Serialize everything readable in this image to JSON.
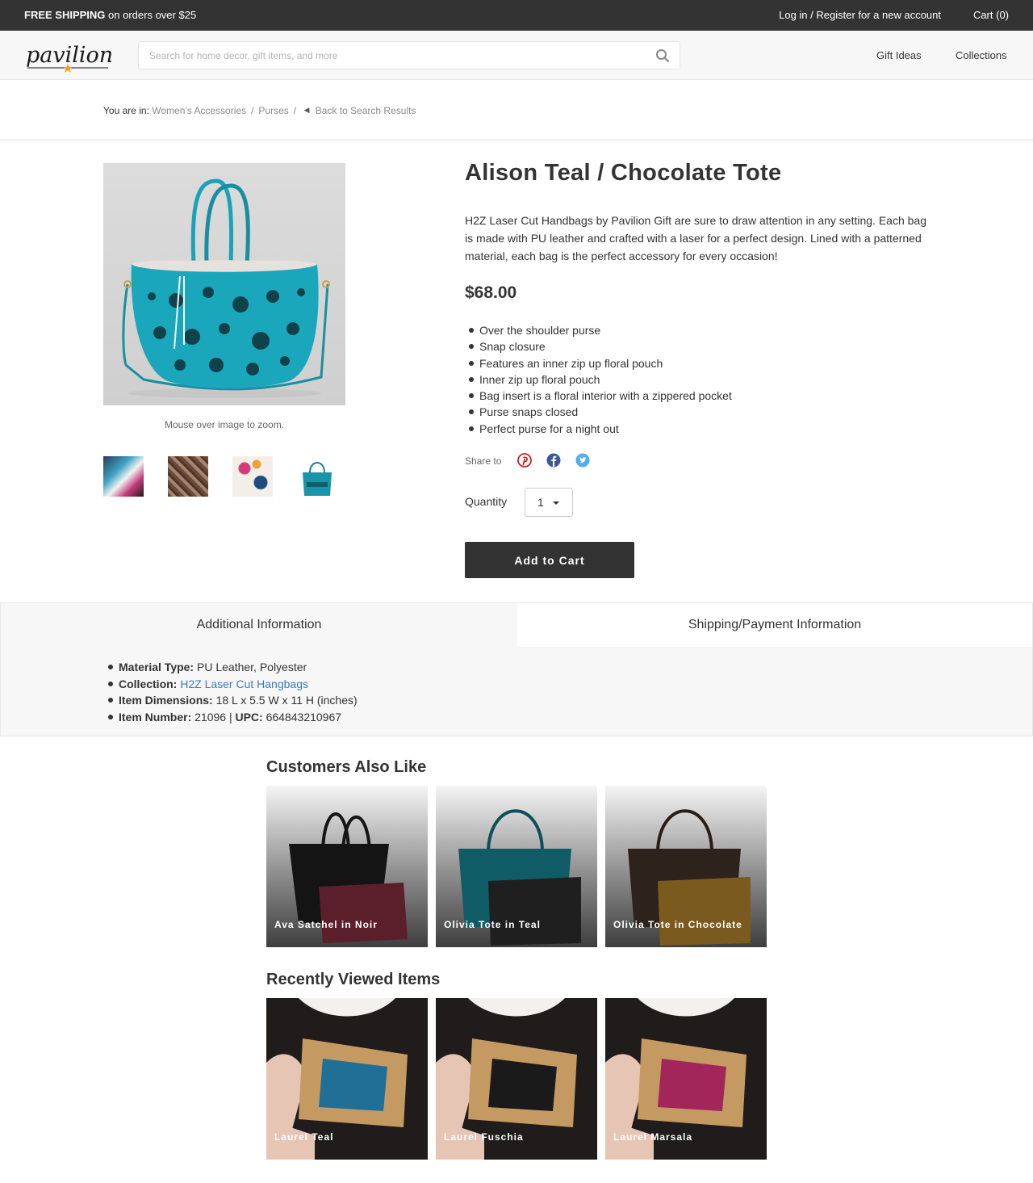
{
  "topbar": {
    "shipping_bold": "FREE SHIPPING",
    "shipping_rest": "on orders over $25",
    "login": "Log in / Register for a new account",
    "cart": "Cart (0)"
  },
  "header": {
    "logo_text": "pavilion",
    "search_placeholder": "Search for home decor, gift items, and more",
    "nav": [
      "Gift Ideas",
      "Collections"
    ]
  },
  "breadcrumb": {
    "prefix": "You are in:",
    "items": [
      "Women's Accessories",
      "Purses"
    ],
    "back": "Back to Search Results"
  },
  "product": {
    "title": "Alison Teal / Chocolate Tote",
    "description": "H2Z Laser Cut Handbags by Pavilion Gift are sure to draw attention in any setting. Each bag is made with PU leather and crafted with a laser for a perfect design. Lined with a patterned material, each bag is the perfect accessory for every occasion!",
    "price": "$68.00",
    "zoom_note": "Mouse over image to zoom.",
    "features": [
      "Over the shoulder purse",
      "Snap closure",
      "Features an inner zip up floral pouch",
      "Inner zip up floral pouch",
      "Bag insert is a floral interior with a zippered pocket",
      "Purse snaps closed",
      "Perfect purse for a night out"
    ],
    "share_label": "Share to",
    "quantity_label": "Quantity",
    "quantity_value": "1",
    "add_to_cart": "Add to Cart",
    "colors": {
      "teal": "#1a9fb3",
      "dark": "#333333"
    }
  },
  "tabs": {
    "additional": "Additional Information",
    "shipping": "Shipping/Payment Information"
  },
  "info": {
    "material_label": "Material Type:",
    "material_value": "PU Leather, Polyester",
    "collection_label": "Collection:",
    "collection_value": "H2Z Laser Cut Hangbags",
    "dimensions_label": "Item Dimensions:",
    "dimensions_value": "18 L x 5.5 W x 11 H (inches)",
    "item_number_label": "Item Number:",
    "item_number_value": "21096",
    "separator": "|",
    "upc_label": "UPC:",
    "upc_value": "664843210967"
  },
  "also_like": {
    "heading": "Customers Also Like",
    "items": [
      "Ava Satchel in Noir",
      "Olivia Tote in Teal",
      "Olivia Tote in Chocolate"
    ]
  },
  "recent": {
    "heading": "Recently Viewed Items",
    "items": [
      "Laurel Teal",
      "Laurel Fuschia",
      "Laurel Marsala"
    ]
  }
}
